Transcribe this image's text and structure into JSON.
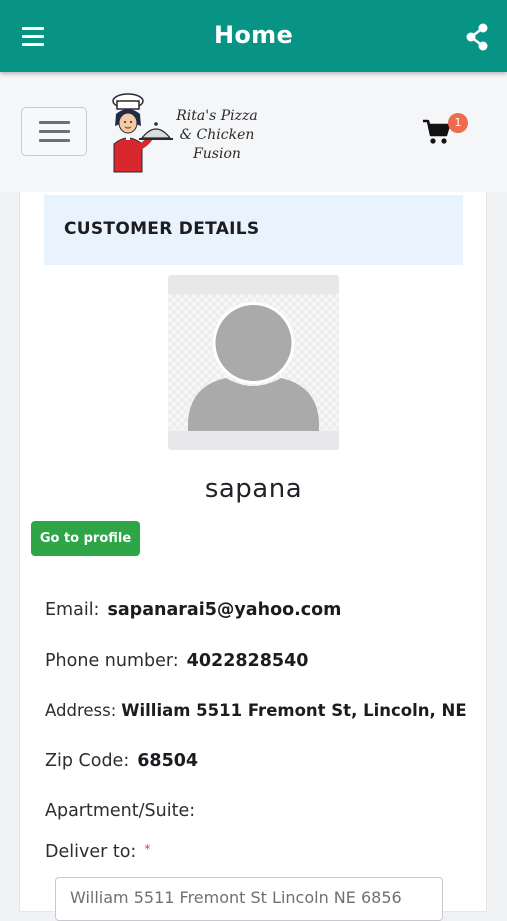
{
  "appbar": {
    "title": "Home",
    "color": "#079484",
    "menu_icon": "hamburger-menu-icon",
    "share_icon": "share-icon"
  },
  "site_header": {
    "logo_text": [
      "Rita's Pizza",
      "& Chicken",
      "Fusion"
    ],
    "cart_badge": "1",
    "cart_icon": "shopping-cart-icon"
  },
  "customer": {
    "section_title": "CUSTOMER DETAILS",
    "username": "sapana",
    "profile_button": "Go to profile",
    "email_label": "Email:",
    "email": "sapanarai5@yahoo.com",
    "phone_label": "Phone number:",
    "phone": "4022828540",
    "address_label": "Address:",
    "address": "William 5511 Fremont St, Lincoln, NE",
    "zip_label": "Zip Code:",
    "zip": "68504",
    "apartment_label": "Apartment/Suite:",
    "deliver_label": "Deliver to:",
    "required_mark": "*",
    "deliver_value": "William 5511 Fremont St Lincoln NE 6856"
  }
}
